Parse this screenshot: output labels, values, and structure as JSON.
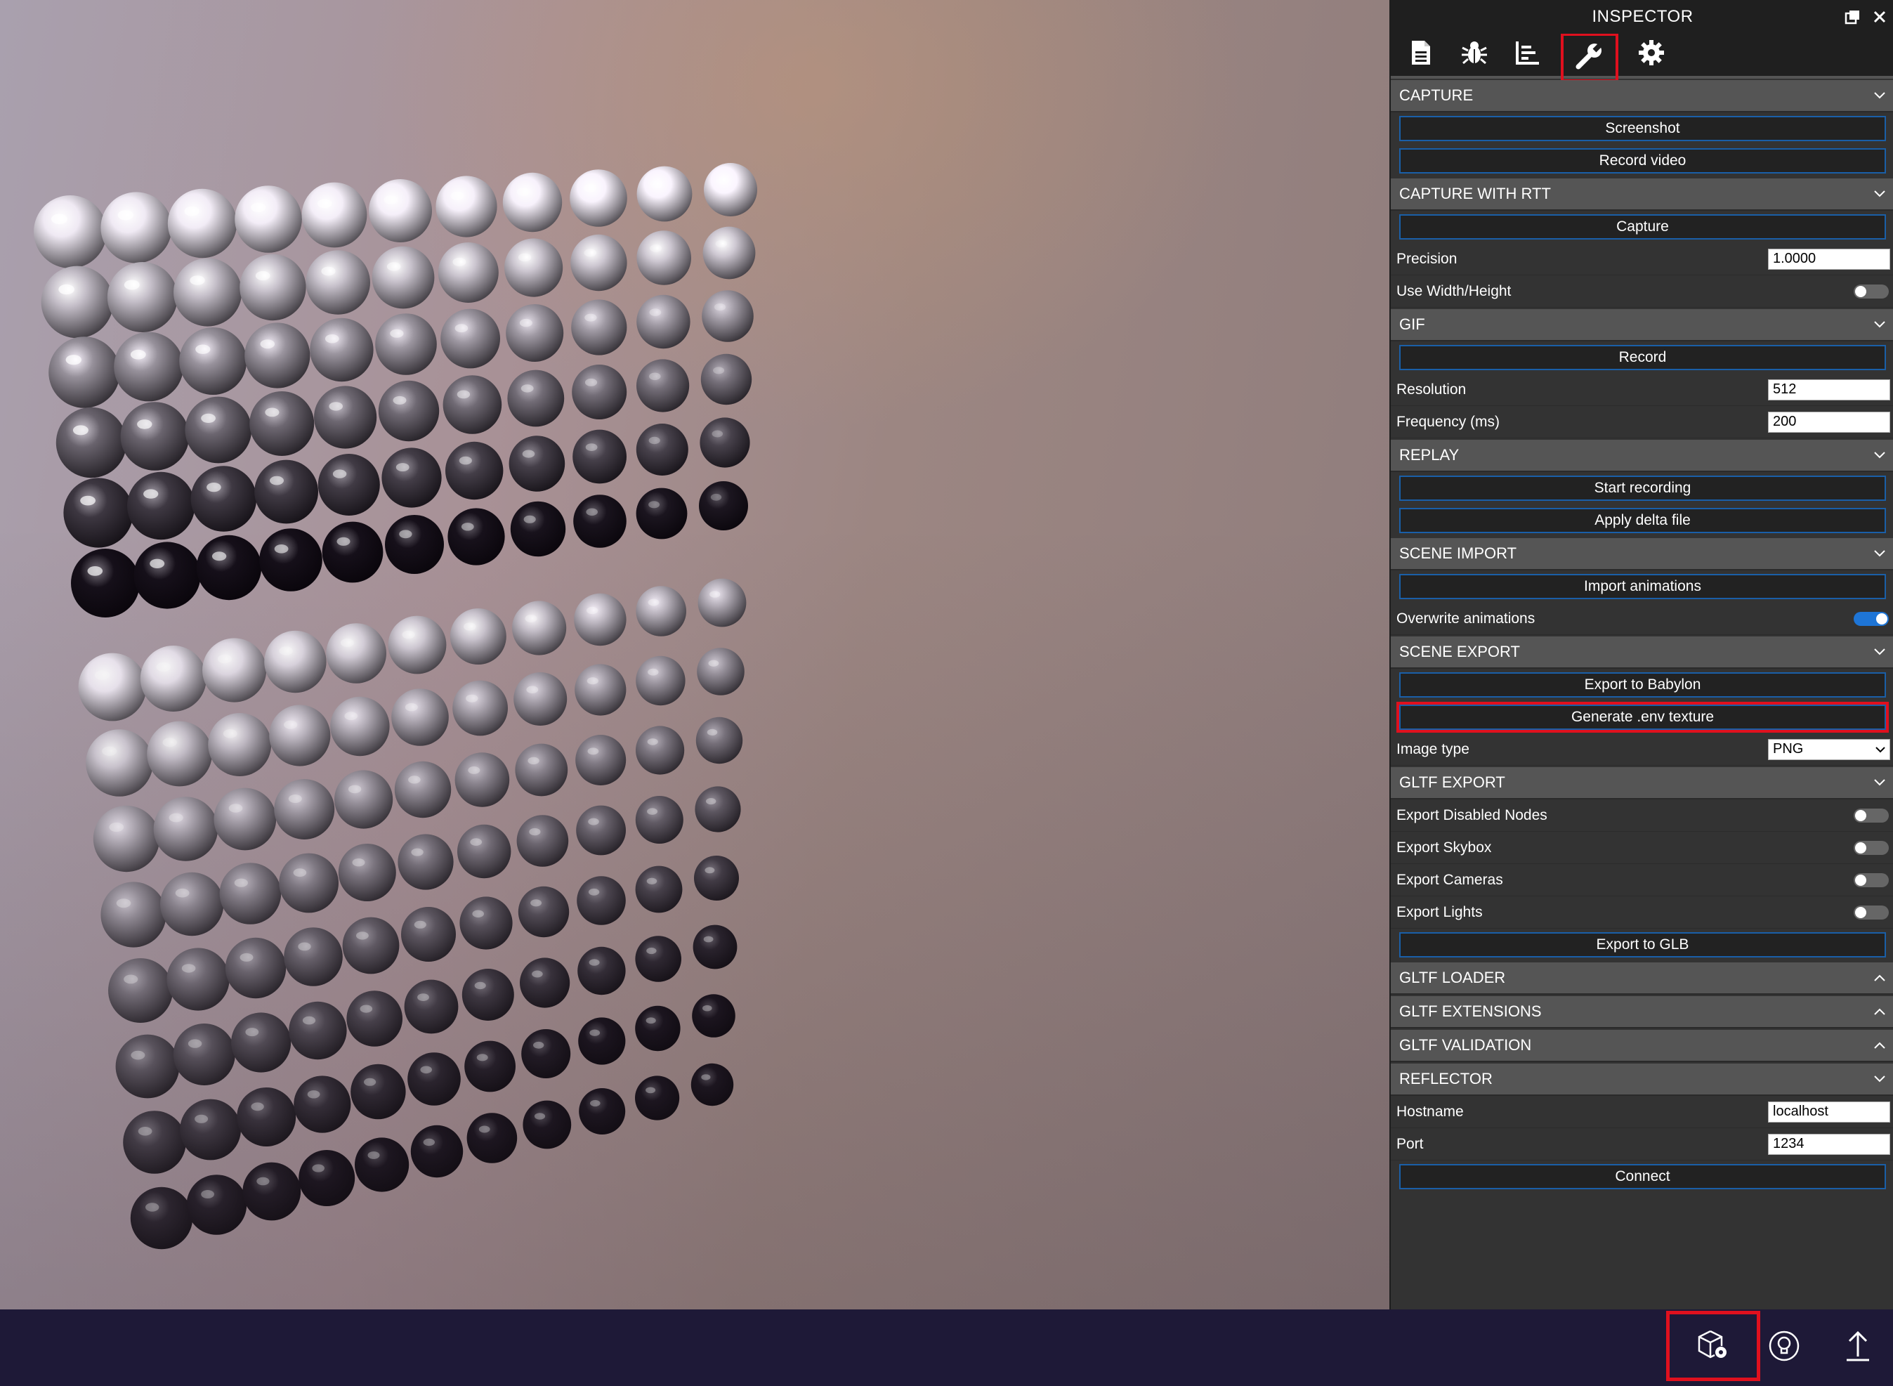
{
  "inspector": {
    "title": "INSPECTOR",
    "title_icons": [
      "popout-icon",
      "close-icon"
    ],
    "tabs": [
      {
        "icon": "file-icon",
        "active": false
      },
      {
        "icon": "bug-icon",
        "active": false
      },
      {
        "icon": "statistics-icon",
        "active": false
      },
      {
        "icon": "wrench-icon",
        "active": true
      },
      {
        "icon": "gear-icon",
        "active": false
      }
    ],
    "capture": {
      "header": "CAPTURE",
      "screenshot": "Screenshot",
      "record_video": "Record video"
    },
    "capture_rtt": {
      "header": "CAPTURE WITH RTT",
      "capture": "Capture",
      "precision_label": "Precision",
      "precision_value": "1.0000",
      "use_wh_label": "Use Width/Height",
      "use_wh_on": false
    },
    "gif": {
      "header": "GIF",
      "record": "Record",
      "resolution_label": "Resolution",
      "resolution_value": "512",
      "frequency_label": "Frequency (ms)",
      "frequency_value": "200"
    },
    "replay": {
      "header": "REPLAY",
      "start_recording": "Start recording",
      "apply_delta": "Apply delta file"
    },
    "scene_import": {
      "header": "SCENE IMPORT",
      "import_animations": "Import animations",
      "overwrite_label": "Overwrite animations",
      "overwrite_on": true
    },
    "scene_export": {
      "header": "SCENE EXPORT",
      "export_babylon": "Export to Babylon",
      "generate_env": "Generate .env texture",
      "image_type_label": "Image type",
      "image_type_value": "PNG"
    },
    "gltf_export": {
      "header": "GLTF EXPORT",
      "disabled_nodes_label": "Export Disabled Nodes",
      "skybox_label": "Export Skybox",
      "cameras_label": "Export Cameras",
      "lights_label": "Export Lights",
      "export_glb": "Export to GLB"
    },
    "gltf_loader": {
      "header": "GLTF LOADER"
    },
    "gltf_extensions": {
      "header": "GLTF EXTENSIONS"
    },
    "gltf_validation": {
      "header": "GLTF VALIDATION"
    },
    "reflector": {
      "header": "REFLECTOR",
      "hostname_label": "Hostname",
      "hostname_value": "localhost",
      "port_label": "Port",
      "port_value": "1234",
      "connect": "Connect"
    }
  },
  "bottombar": {
    "icons": [
      "scene-settings-icon",
      "lightbulb-icon",
      "upload-icon"
    ]
  },
  "colors": {
    "accent_blue": "#1e75d6",
    "highlight_red": "#e0101e",
    "panel_bg": "#333333",
    "section_bg": "#555555",
    "bottombar_bg": "#1e1937"
  }
}
